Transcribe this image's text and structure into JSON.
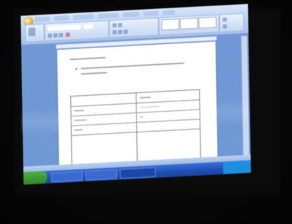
{
  "scene": {
    "description_colors": {
      "background": "#050505",
      "bezel": "#0b0b0b",
      "screen_backdrop": "#6f98d4",
      "ribbon": "#b7cff0",
      "page": "#ffffff",
      "taskbar": "#1f4fb5",
      "start_button": "#2f8a24"
    }
  },
  "icons": {
    "office_button": "office-button-icon",
    "start": "windows-start-icon",
    "tray": "system-tray-icon"
  }
}
